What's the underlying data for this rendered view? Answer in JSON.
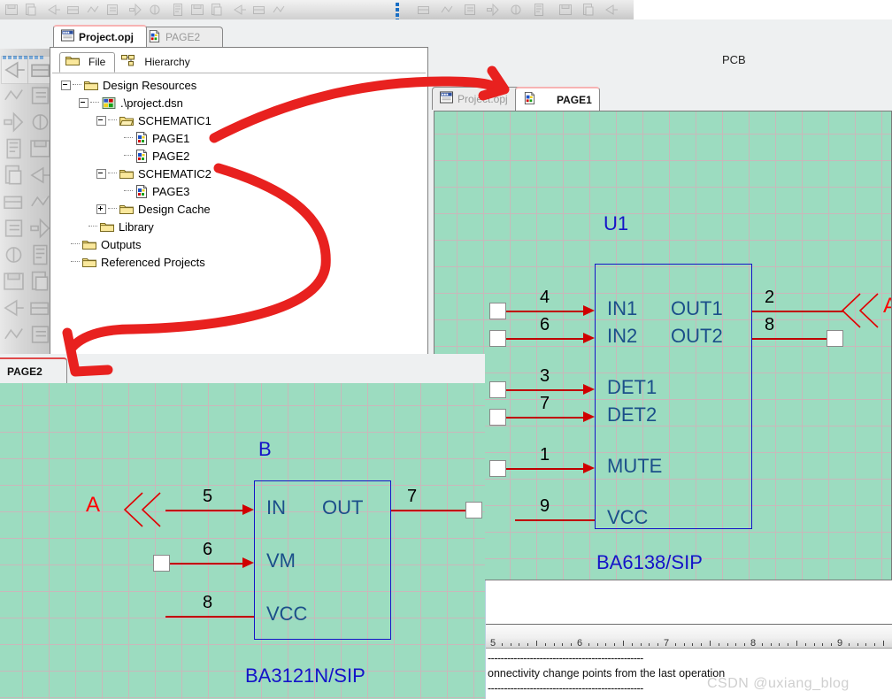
{
  "app": {
    "pcb_label": "PCB"
  },
  "top_toolbar": {
    "icons": [
      "save-icon",
      "copy-pages-icon",
      "net-icon",
      "annotate-icon",
      "backannotate-icon",
      "update-properties-icon",
      "drc-icon",
      "bom-icon",
      "export-netlist-icon",
      "cross-reference-icon",
      "project-manager-icon",
      "design-rules-icon",
      "netlist-icon",
      "place-part-icon"
    ],
    "group2_icons": [
      "align-left-icon",
      "align-center-icon",
      "align-right-icon",
      "align-top-icon",
      "align-middle-icon",
      "align-bottom-icon",
      "space-horizontal-icon",
      "space-vertical-icon",
      "delete-icon"
    ]
  },
  "left_toolbar": {
    "icons": [
      "select-arrow-icon",
      "place-part-icon",
      "place-wire-icon",
      "place-net-alias-icon",
      "place-bus-icon",
      "place-junction-icon",
      "place-bus-entry-icon",
      "place-text-icon",
      "place-power-icon",
      "place-no-connect-icon",
      "place-off-page-icon",
      "place-hierarchical-block-icon",
      "place-hierarchical-port-icon",
      "place-hierarchical-pin-icon",
      "place-ground-icon",
      "place-ellipse-icon",
      "place-polyline-icon",
      "place-rectangle-icon",
      "zoom-in-icon",
      "zoom-out-icon",
      "zoom-area-icon",
      "zoom-selection-icon"
    ]
  },
  "project_window": {
    "tabs": [
      {
        "label": "Project.opj",
        "icon": "project-opj-icon",
        "active": true
      },
      {
        "label": "PAGE2",
        "icon": "schematic-page-icon",
        "active": false
      }
    ],
    "subtabs": [
      {
        "label": "File",
        "icon": "folder-icon",
        "active": true
      },
      {
        "label": "Hierarchy",
        "icon": "hierarchy-icon",
        "active": false
      }
    ],
    "tree": [
      {
        "label": "Design Resources",
        "indent": 0,
        "toggle": "minus",
        "icon": "folder-icon"
      },
      {
        "label": ".\\project.dsn",
        "indent": 1,
        "toggle": "minus",
        "icon": "design-icon"
      },
      {
        "label": "SCHEMATIC1",
        "indent": 2,
        "toggle": "minus",
        "icon": "folder-open-icon"
      },
      {
        "label": "PAGE1",
        "indent": 3,
        "toggle": "none",
        "icon": "page-icon"
      },
      {
        "label": "PAGE2",
        "indent": 3,
        "toggle": "none",
        "icon": "page-icon"
      },
      {
        "label": "SCHEMATIC2",
        "indent": 2,
        "toggle": "minus",
        "icon": "folder-icon"
      },
      {
        "label": "PAGE3",
        "indent": 3,
        "toggle": "none",
        "icon": "page-icon"
      },
      {
        "label": "Design Cache",
        "indent": 2,
        "toggle": "plus",
        "icon": "folder-icon"
      },
      {
        "label": "Library",
        "indent": 1,
        "toggle": "none",
        "icon": "folder-icon"
      },
      {
        "label": "Outputs",
        "indent": 0,
        "toggle": "none",
        "icon": "folder-icon"
      },
      {
        "label": "Referenced Projects",
        "indent": 0,
        "toggle": "none",
        "icon": "folder-icon"
      }
    ]
  },
  "page1_window": {
    "tabs": [
      {
        "label": "Project.opj",
        "icon": "project-opj-icon",
        "active": false
      },
      {
        "label": "PAGE1",
        "icon": "schematic-page-icon",
        "active": true
      }
    ],
    "schematic": {
      "refdes": "U1",
      "part_name": "BA6138/SIP",
      "left_pins": [
        {
          "number": "4",
          "name": "IN1",
          "has_arrow": true,
          "has_square": true
        },
        {
          "number": "6",
          "name": "IN2",
          "has_arrow": true,
          "has_square": true
        },
        {
          "number": "3",
          "name": "DET1",
          "has_arrow": true,
          "has_square": true
        },
        {
          "number": "7",
          "name": "DET2",
          "has_arrow": true,
          "has_square": true
        },
        {
          "number": "1",
          "name": "MUTE",
          "has_arrow": true,
          "has_square": true
        },
        {
          "number": "9",
          "name": "VCC",
          "has_arrow": false,
          "has_square": false
        }
      ],
      "right_pins": [
        {
          "number": "2",
          "name": "OUT1",
          "connector": "A",
          "has_square": false
        },
        {
          "number": "8",
          "name": "OUT2",
          "connector": "",
          "has_square": true
        }
      ],
      "offpage_connector": "A"
    }
  },
  "page2_window": {
    "tabs": [
      {
        "label": "PAGE2",
        "active": true
      }
    ],
    "schematic": {
      "refdes": "B",
      "part_name": "BA3121N/SIP",
      "left_pins": [
        {
          "number": "5",
          "name": "IN",
          "has_arrow": true,
          "has_square": false,
          "connector": "A"
        },
        {
          "number": "6",
          "name": "VM",
          "has_arrow": true,
          "has_square": true,
          "connector": ""
        },
        {
          "number": "8",
          "name": "VCC",
          "has_arrow": false,
          "has_square": false,
          "connector": ""
        }
      ],
      "right_pins": [
        {
          "number": "7",
          "name": "OUT",
          "has_square": true
        }
      ],
      "offpage_connector": "A"
    }
  },
  "log_panel": {
    "ruler_ticks": [
      "5",
      "6",
      "7",
      "8",
      "9"
    ],
    "line1": "------------------------------------------------",
    "line2": "onnectivity change points from the last operation",
    "line3": "------------------------------------------------",
    "watermark": "CSDN @uxiang_blog"
  },
  "colors": {
    "canvas_green": "#9cdcc0",
    "grid_line": "#c9b8bb",
    "wire_red": "#c00000",
    "symbol_blue": "#1414c8",
    "pin_text_blue": "#1b4f8a",
    "connector_red": "#ff0000",
    "annotation_red": "#e8211f"
  }
}
